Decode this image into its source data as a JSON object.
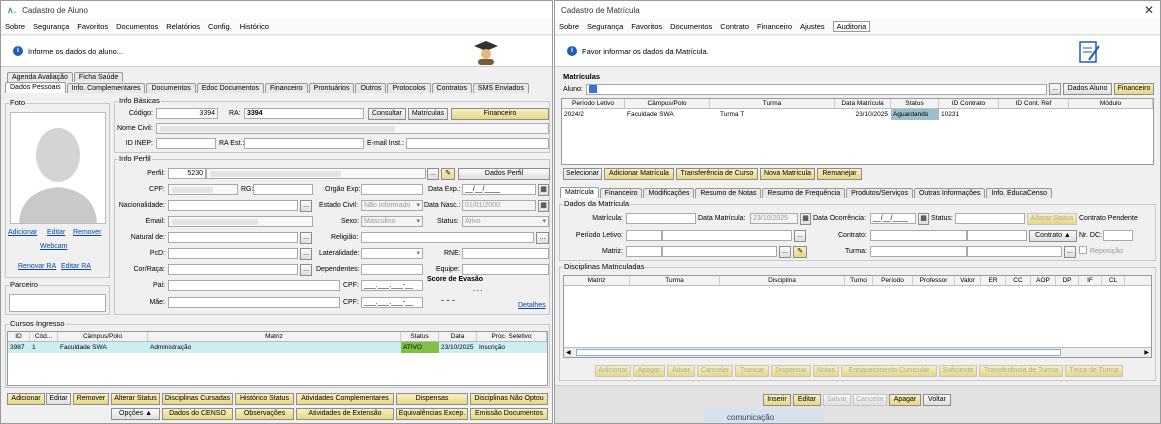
{
  "left": {
    "title": "Cadastro de Aluno",
    "menu": [
      "Sobre",
      "Segurança",
      "Favoritos",
      "Documentos",
      "Relatórios",
      "Config.",
      "Histórico"
    ],
    "hint": "Informe os dados do aluno...",
    "tabs_row1": [
      "Agenda Avaliação",
      "Ficha Saúde"
    ],
    "tabs_row2": [
      "Dados Pessoais",
      "Info. Complementares",
      "Documentos",
      "Edoc Documentos",
      "Financeiro",
      "Prontuários",
      "Outros",
      "Protocolos",
      "Contratos",
      "SMS Enviados"
    ],
    "foto_label": "Foto",
    "photo_links": {
      "adicionar": "Adicionar",
      "editar": "Editar",
      "remover": "Remover",
      "webcam": "Webcam",
      "renovar": "Renovar RA",
      "editar_ra": "Editar RA"
    },
    "parceiro": "Parceiro",
    "basic": {
      "group": "Info Básicas",
      "codigo_label": "Código:",
      "codigo": "3394",
      "ra_label": "RA:",
      "ra": "3394",
      "consultar": "Consultar",
      "matriculas": "Matrículas",
      "financeiro": "Financeiro",
      "nome_label": "Nome Civil:",
      "inep_label": "ID INEP:",
      "ra_est_label": "RA Est.:",
      "email_inst_label": "E-mail Inst.:"
    },
    "perfil": {
      "group": "Info Perfil",
      "perfil_label": "Perfil:",
      "perfil": "5230",
      "dados_perfil": "Dados Perfil",
      "cpf_label": "CPF:",
      "rg_label": "RG:",
      "orgao_label": "Orgão Exp:",
      "data_exp_label": "Data Exp.:",
      "data_exp": "__/__/____",
      "nacionalidade_label": "Nacionalidade:",
      "estado_civil_label": "Estado Civil:",
      "estado_civil": "Não Informado",
      "data_nasc_label": "Data Nasc.:",
      "data_nasc": "01/01/2000",
      "email_label": "Email:",
      "sexo_label": "Sexo:",
      "sexo": "Masculino",
      "status_label": "Status:",
      "status": "Ativo",
      "natural_label": "Natural de:",
      "religiao_label": "Religião:",
      "pcd_label": "PcD:",
      "lateralidade_label": "Lateralidade:",
      "rne_label": "RNE:",
      "cor_label": "Cor/Raça:",
      "dependentes_label": "Dependentes:",
      "equipe_label": "Equipe:",
      "pai_label": "Pai:",
      "cpf2_label": "CPF:",
      "cpf_mask": "___.___.___-__",
      "mae_label": "Mãe:",
      "cpf3_label": "CPF:",
      "evasao_label": "Score de Evasão",
      "evasao_value": "- - -",
      "evasao_small": "- - -",
      "detalhes": "Detalhes"
    },
    "cursos": {
      "group": "Cursos Ingresso",
      "headers": [
        "ID",
        "Cód...",
        "Câmpus/Polo",
        "Matriz",
        "Status",
        "Data",
        "Proc. Seletivo"
      ],
      "rows": [
        [
          "3987",
          "1",
          "Faculdade SWA",
          "Administração",
          "ATIVO",
          "23/10/2025",
          "Inscrição"
        ]
      ]
    },
    "buttons_row1": [
      "Adicionar",
      "Editar",
      "Remover",
      "Alterar Status",
      "Disciplinas Cursadas",
      "Histórico Status",
      "Atividades Complementares",
      "Dispensas",
      "Disciplinas Não Optou"
    ],
    "buttons_row2": [
      "Opções ▲",
      "Dados do CENSO",
      "Observações",
      "Atividades de Extensão",
      "Equivalências Excep.",
      "Emissão Documentos"
    ]
  },
  "right": {
    "title": "Cadastro de Matrícula",
    "menu": [
      "Sobre",
      "Segurança",
      "Favoritos",
      "Documentos",
      "Contrato",
      "Financeiro",
      "Ajustes",
      "Auditoria"
    ],
    "hint": "Favor informar os dados da Matrícula.",
    "matriculas_group": "Matrículas",
    "aluno_label": "Aluno:",
    "dados_aluno": "Dados Aluno",
    "financeiro": "Financeiro",
    "headers": [
      "Período Letivo",
      "Câmpus/Polo",
      "Turma",
      "Data Matrícula",
      "Status",
      "ID Contrato",
      "ID Cont. Ref",
      "Módulo"
    ],
    "rows": [
      [
        "2024/2",
        "Faculdade SWA",
        "Turma T",
        "23/10/2025",
        "Aguardando",
        "10231",
        "",
        ""
      ]
    ],
    "actions": [
      "Selecionar",
      "Adicionar Matrícula",
      "Transferência de Curso",
      "Nova Matrícula",
      "Remanejar"
    ],
    "tabs": [
      "Matrícula",
      "Financeiro",
      "Modificações",
      "Resumo de Notas",
      "Resumo de Frequência",
      "Produtos/Serviços",
      "Outras Informações",
      "Info. EducaCenso"
    ],
    "dados_group": "Dados da Matrícula",
    "form": {
      "matricula_label": "Matrícula:",
      "data_mat_label": "Data Matrícula:",
      "data_mat": "23/10/2025",
      "data_oc_label": "Data Ocorrência:",
      "data_oc": "__/__/____",
      "status_label": "Status:",
      "alterar_status": "Alterar Status",
      "contrato_pendente": "Contrato Pendente",
      "periodo_label": "Período Letivo:",
      "contrato_label": "Contrato:",
      "contrato_btn": "Contrato ▲",
      "nr_dc_label": "Nr. DC:",
      "matriz_label": "Matriz:",
      "turma_label": "Turma:",
      "reposicao": "Reposição"
    },
    "disc_group": "Disciplinas Matriculadas",
    "disc_headers": [
      "Matriz",
      "Turma",
      "Disciplina",
      "Turno",
      "Período",
      "Professor",
      "Valor",
      "ER",
      "CC",
      "AOP",
      "DP",
      "IF",
      "CL"
    ],
    "disc_actions": [
      "Adicionar",
      "Apagar",
      "Ativar",
      "Cancelar",
      "Trancar",
      "Dispensar",
      "Notas",
      "Enriquecimento Curricular",
      "Suficiente",
      "Transferência de Turma",
      "Troca de Turma"
    ],
    "bottom": [
      "Inserir",
      "Editar",
      "Salvar",
      "Cancelar",
      "Apagar",
      "Voltar"
    ],
    "behind_text": "comunicação"
  }
}
